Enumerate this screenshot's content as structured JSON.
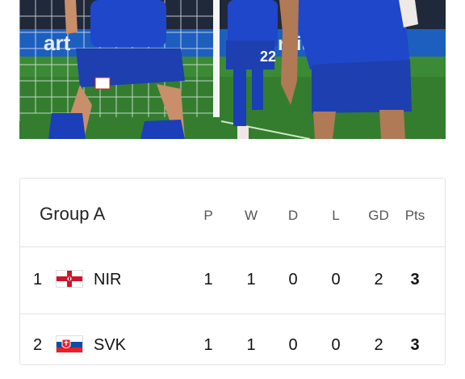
{
  "banner": {
    "ad_text": "art",
    "ad_text2": "rait",
    "player_number": "22"
  },
  "standings": {
    "group_title": "Group A",
    "columns": [
      "P",
      "W",
      "D",
      "L",
      "GD",
      "Pts"
    ],
    "rows": [
      {
        "rank": "1",
        "team": "NIR",
        "flag": "northern-ireland-flag-icon",
        "p": "1",
        "w": "1",
        "d": "0",
        "l": "0",
        "gd": "2",
        "pts": "3"
      },
      {
        "rank": "2",
        "team": "SVK",
        "flag": "slovakia-flag-icon",
        "p": "1",
        "w": "1",
        "d": "0",
        "l": "0",
        "gd": "2",
        "pts": "3"
      }
    ]
  }
}
